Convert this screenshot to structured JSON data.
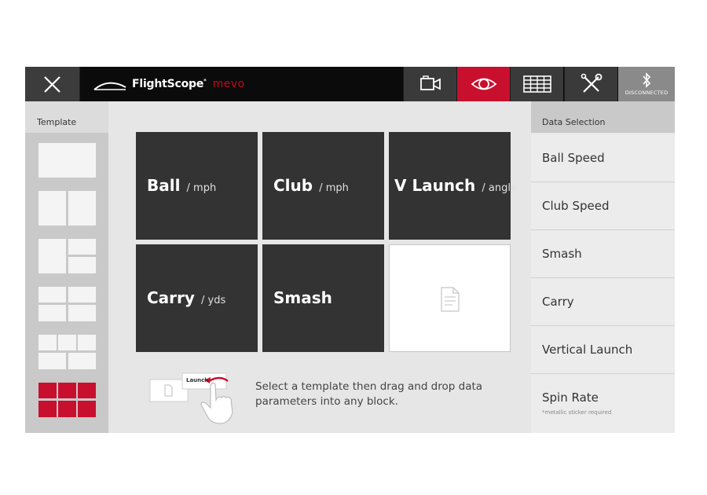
{
  "header": {
    "brand": "FlightScope",
    "brand_tm": "*",
    "product": "mevo",
    "status_text": "DISCONNECTED",
    "icons": [
      "close-icon",
      "video-camera-icon",
      "eye-icon",
      "table-grid-icon",
      "tools-icon",
      "bluetooth-icon"
    ],
    "active_tab": "eye-icon"
  },
  "template_panel": {
    "title": "Template",
    "templates": [
      "1 block",
      "2 blocks",
      "3 blocks",
      "4 blocks",
      "5 blocks",
      "6 blocks"
    ],
    "selected_index": 5
  },
  "grid": {
    "blocks": [
      {
        "name": "Ball",
        "unit": "/ mph"
      },
      {
        "name": "Club",
        "unit": "/ mph"
      },
      {
        "name": "V Launch",
        "unit": "/ angle"
      },
      {
        "name": "Carry",
        "unit": "/ yds"
      },
      {
        "name": "Smash",
        "unit": ""
      },
      {
        "name": "",
        "unit": ""
      }
    ]
  },
  "hint": {
    "drag_card_label": "Launch",
    "text": "Select a template then drag and drop data parameters into any block."
  },
  "data_selection": {
    "title": "Data Selection",
    "items": [
      {
        "label": "Ball Speed",
        "note": ""
      },
      {
        "label": "Club Speed",
        "note": ""
      },
      {
        "label": "Smash",
        "note": ""
      },
      {
        "label": "Carry",
        "note": ""
      },
      {
        "label": "Vertical Launch",
        "note": ""
      },
      {
        "label": "Spin Rate",
        "note": "*metallic sticker required"
      }
    ]
  },
  "colors": {
    "accent": "#c8102e",
    "topbar": "#0b0b0b",
    "block": "#333333",
    "panel": "#e6e6e6"
  }
}
